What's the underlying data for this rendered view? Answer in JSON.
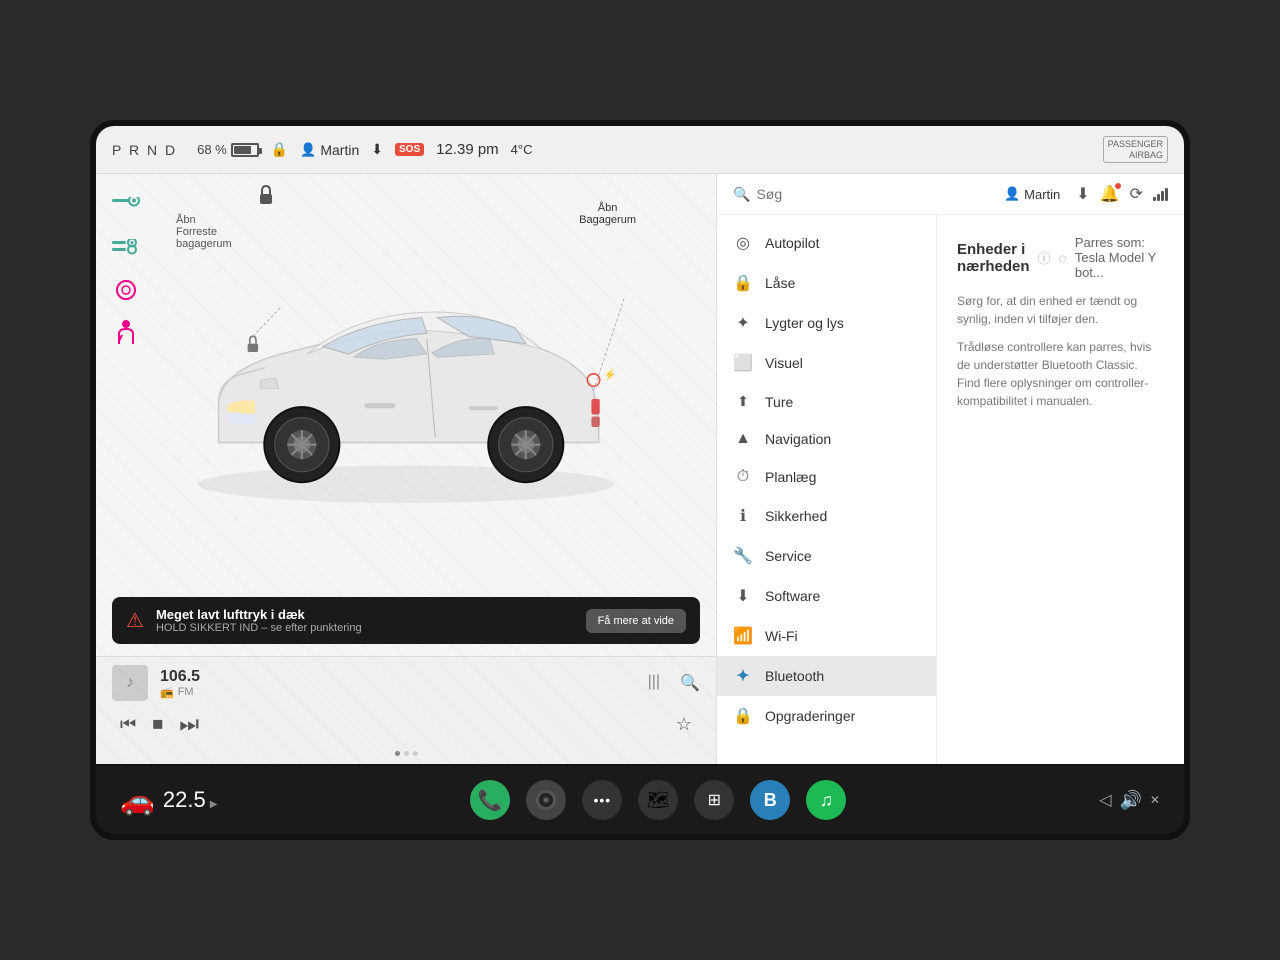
{
  "statusBar": {
    "prnd": "P R N D",
    "battery_pct": "68 %",
    "lock_icon": "🔒",
    "user_icon": "👤",
    "user_name": "Martin",
    "download_icon": "⬇",
    "sos": "SOS",
    "time": "12.39 pm",
    "temp": "4°C",
    "passenger_airbag_line1": "PASSENGER",
    "passenger_airbag_line2": "AIRBAG"
  },
  "leftIcons": [
    {
      "name": "drive-icon",
      "symbol": "≡⊙"
    },
    {
      "name": "eco-icon",
      "symbol": "≡⊙⊙"
    },
    {
      "name": "tire-icon",
      "symbol": "⊙"
    },
    {
      "name": "person-icon",
      "symbol": "🚶"
    }
  ],
  "carLabels": {
    "trunk_label": "Åbn\nBagagerum",
    "front_trunk_label": "Åbn\nForrreste\nbagagerum"
  },
  "warning": {
    "title": "Meget lavt lufttryk i dæk",
    "subtitle": "HOLD SIKKERT IND – se efter punktering",
    "button": "Få mere at vide"
  },
  "musicPlayer": {
    "station": "106.5",
    "type": "FM",
    "type_icon": "📻"
  },
  "search": {
    "placeholder": "Søg",
    "user_name": "Martin"
  },
  "menuItems": [
    {
      "id": "autopilot",
      "label": "Autopilot",
      "icon": "◎"
    },
    {
      "id": "laase",
      "label": "Låse",
      "icon": "🔒"
    },
    {
      "id": "lygter",
      "label": "Lygter og lys",
      "icon": "✦"
    },
    {
      "id": "visuel",
      "label": "Visuel",
      "icon": "⬜"
    },
    {
      "id": "ture",
      "label": "Ture",
      "icon": "⬆"
    },
    {
      "id": "navigation",
      "label": "Navigation",
      "icon": "▲"
    },
    {
      "id": "planlaeg",
      "label": "Planlæg",
      "icon": "⏱"
    },
    {
      "id": "sikkerhed",
      "label": "Sikkerhed",
      "icon": "ℹ"
    },
    {
      "id": "service",
      "label": "Service",
      "icon": "🔧"
    },
    {
      "id": "software",
      "label": "Software",
      "icon": "⬇"
    },
    {
      "id": "wifi",
      "label": "Wi-Fi",
      "icon": "📶"
    },
    {
      "id": "bluetooth",
      "label": "Bluetooth",
      "icon": "🔵",
      "active": true
    },
    {
      "id": "opgraderinger",
      "label": "Opgraderinger",
      "icon": "🔒"
    }
  ],
  "bluetoothPanel": {
    "section_title": "Enheder i nærheden",
    "info_icon": "ⓘ",
    "paired_loading": "◌",
    "paired_label": "Parres som: Tesla Model Y bot...",
    "desc1": "Sørg for, at din enhed er tændt og synlig, inden vi tilføjer den.",
    "desc2": "Trådløse controllere kan parres, hvis de understøtter Bluetooth Classic. Find flere oplysninger om controller-kompatibilitet i manualen."
  },
  "taskbar": {
    "temp": "22.5",
    "temp_unit": "",
    "car_icon": "🚗",
    "phone_icon": "📞",
    "camera_icon": "⬤",
    "dots_icon": "•••",
    "maps_icon": "🗺",
    "grid_icon": "⊞",
    "bluetooth_icon": "B",
    "spotify_icon": "♫",
    "volume_icon": "🔊",
    "mute_icon": "✕"
  }
}
